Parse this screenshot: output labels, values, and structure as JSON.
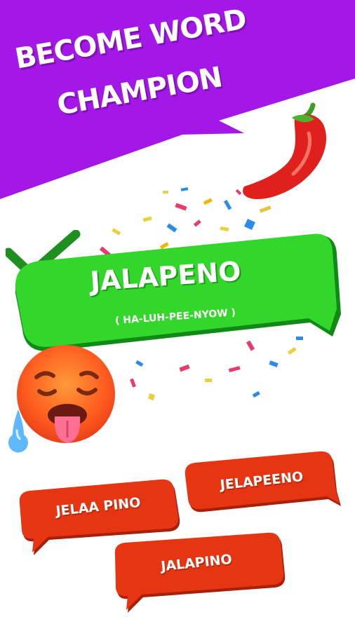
{
  "banner": {
    "line1": "BECOME WORD",
    "line2": "CHAMPION",
    "color": "#a318e6"
  },
  "question": {
    "word": "JALAPENO",
    "pronunciation": "( HA-LUH-PEE-NYOW )",
    "bubble_color": "#2bd62b",
    "status": "correct"
  },
  "options": [
    {
      "label": "JELAA PINO"
    },
    {
      "label": "JELAPEENO"
    },
    {
      "label": "JALAPINO"
    }
  ],
  "option_color": "#e53512",
  "icons": [
    "pepper-icon",
    "checkmark-icon",
    "hot-face-emoji-icon",
    "confetti-icon"
  ]
}
